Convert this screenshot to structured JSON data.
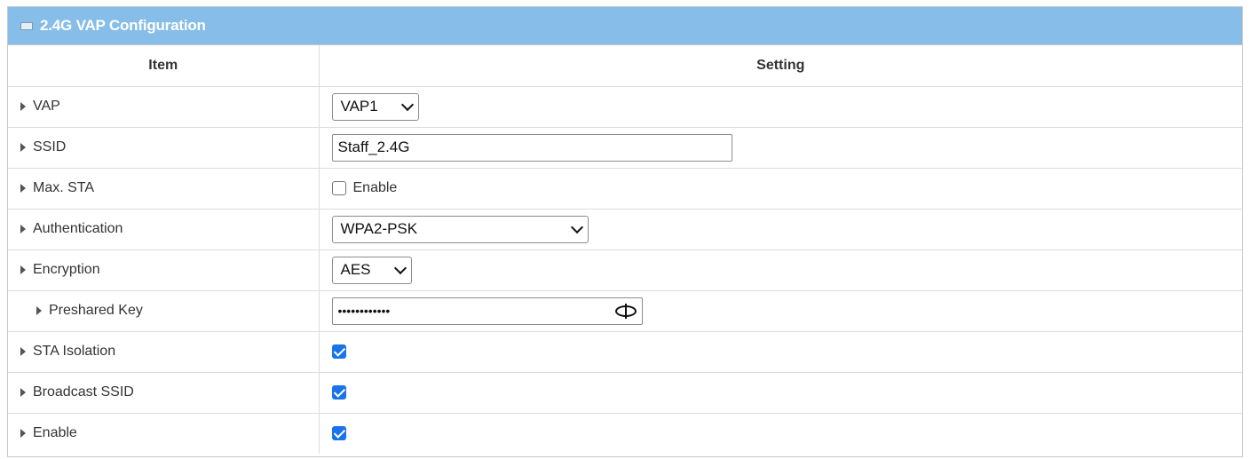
{
  "panel": {
    "title": "2.4G VAP Configuration"
  },
  "table": {
    "col_item": "Item",
    "col_setting": "Setting"
  },
  "rows": {
    "vap": {
      "label": "VAP",
      "value": "VAP1"
    },
    "ssid": {
      "label": "SSID",
      "value": "Staff_2.4G"
    },
    "max_sta": {
      "label": "Max. STA",
      "checkbox_label": "Enable",
      "checked": false
    },
    "authentication": {
      "label": "Authentication",
      "value": "WPA2-PSK"
    },
    "encryption": {
      "label": "Encryption",
      "value": "AES"
    },
    "preshared_key": {
      "label": "Preshared Key",
      "value": "••••••••••••"
    },
    "sta_isolation": {
      "label": "STA Isolation",
      "checked": true
    },
    "broadcast_ssid": {
      "label": "Broadcast SSID",
      "checked": true
    },
    "enable": {
      "label": "Enable",
      "checked": true
    }
  },
  "colors": {
    "header_bar": "#86bde9",
    "checkbox_checked": "#1a73e8"
  }
}
